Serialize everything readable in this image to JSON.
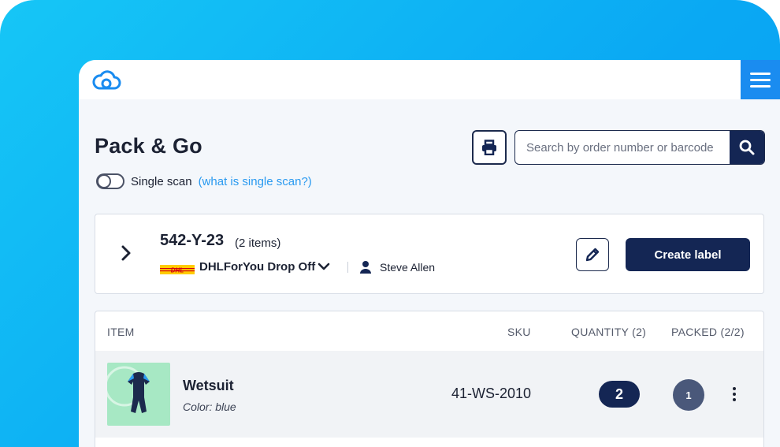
{
  "app": {
    "logo_icon": "cloud-logo-icon",
    "menu_icon": "hamburger-menu-icon",
    "accent": "#1a8cf0",
    "primary_dark": "#142654"
  },
  "page": {
    "title": "Pack & Go",
    "single_scan_label": "Single scan",
    "single_scan_link": "(what is single scan?)",
    "single_scan_enabled": false
  },
  "toolbar": {
    "print_icon": "print-icon",
    "search_placeholder": "Search by order number or barcode",
    "search_value": "",
    "search_icon": "search-icon"
  },
  "order": {
    "id": "542-Y-23",
    "item_count": "(2 items)",
    "carrier_logo": "DHL",
    "carrier": "DHLForYou Drop Off",
    "user": "Steve Allen",
    "edit_icon": "pencil-icon",
    "create_label": "Create label"
  },
  "table": {
    "headers": {
      "item": "ITEM",
      "sku": "SKU",
      "quantity": "QUANTITY (2)",
      "packed": "PACKED (2/2)"
    },
    "rows": [
      {
        "name": "Wetsuit",
        "color": "Color: blue",
        "sku": "41-WS-2010",
        "quantity": "2",
        "packed": "1"
      }
    ]
  }
}
